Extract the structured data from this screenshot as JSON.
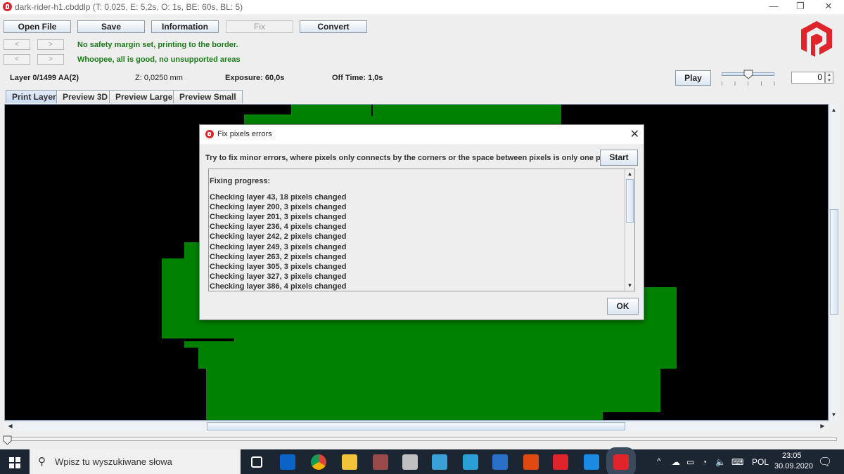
{
  "window": {
    "title": "dark-rider-h1.cbddlp (T: 0,025, E: 5,2s, O: 1s, BE: 60s, BL: 5)",
    "controls": {
      "minimize": "—",
      "maximize": "❐",
      "close": "✕"
    }
  },
  "toolbar": {
    "open_file": "Open File",
    "save": "Save",
    "information": "Information",
    "fix": "Fix",
    "convert": "Convert"
  },
  "nav": {
    "prev": "<",
    "next": ">"
  },
  "status": {
    "margin": "No safety margin set, printing to the border.",
    "support": "Whoopee, all is good, no unsupported areas",
    "color": "#1a7a1a"
  },
  "layer_info": {
    "layer": "Layer 0/1499 AA(2)",
    "z": "Z: 0,0250 mm",
    "exposure": "Exposure: 60,0s",
    "off_time": "Off Time: 1,0s"
  },
  "playback": {
    "play": "Play",
    "speed_slider_position": 0.5,
    "layer_spinner_value": "0"
  },
  "tabs": [
    {
      "label": "Print Layer",
      "active": true
    },
    {
      "label": "Preview 3D",
      "active": false
    },
    {
      "label": "Preview Large",
      "active": false
    },
    {
      "label": "Preview Small",
      "active": false
    }
  ],
  "layer_slider": {
    "value": 0,
    "max": 1499
  },
  "colors": {
    "layer_fill": "#008200",
    "background": "#000000",
    "brand": "#e0242b"
  },
  "dialog": {
    "title": "Fix pixels errors",
    "description": "Try to fix minor errors, where pixels only connects by the corners or the space between pixels is only one pixel.",
    "start": "Start",
    "ok": "OK",
    "log_header": "Fixing progress:",
    "log": [
      "Checking layer 43, 18 pixels changed",
      "Checking layer 200, 3 pixels changed",
      "Checking layer 201, 3 pixels changed",
      "Checking layer 236, 4 pixels changed",
      "Checking layer 242, 2 pixels changed",
      "Checking layer 249, 3 pixels changed",
      "Checking layer 263, 2 pixels changed",
      "Checking layer 305, 3 pixels changed",
      "Checking layer 327, 3 pixels changed",
      "Checking layer 386, 4 pixels changed"
    ]
  },
  "taskbar": {
    "search_placeholder": "Wpisz tu wyszukiwane słowa",
    "apps": [
      "task-view",
      "outlook",
      "chrome",
      "file-explorer",
      "cube-app",
      "paint-app",
      "photo-app",
      "n-app",
      "window-app",
      "office",
      "chitubox",
      "c-app",
      "photon-app-active"
    ],
    "language": "POL",
    "time": "23:05",
    "date": "30.09.2020"
  }
}
